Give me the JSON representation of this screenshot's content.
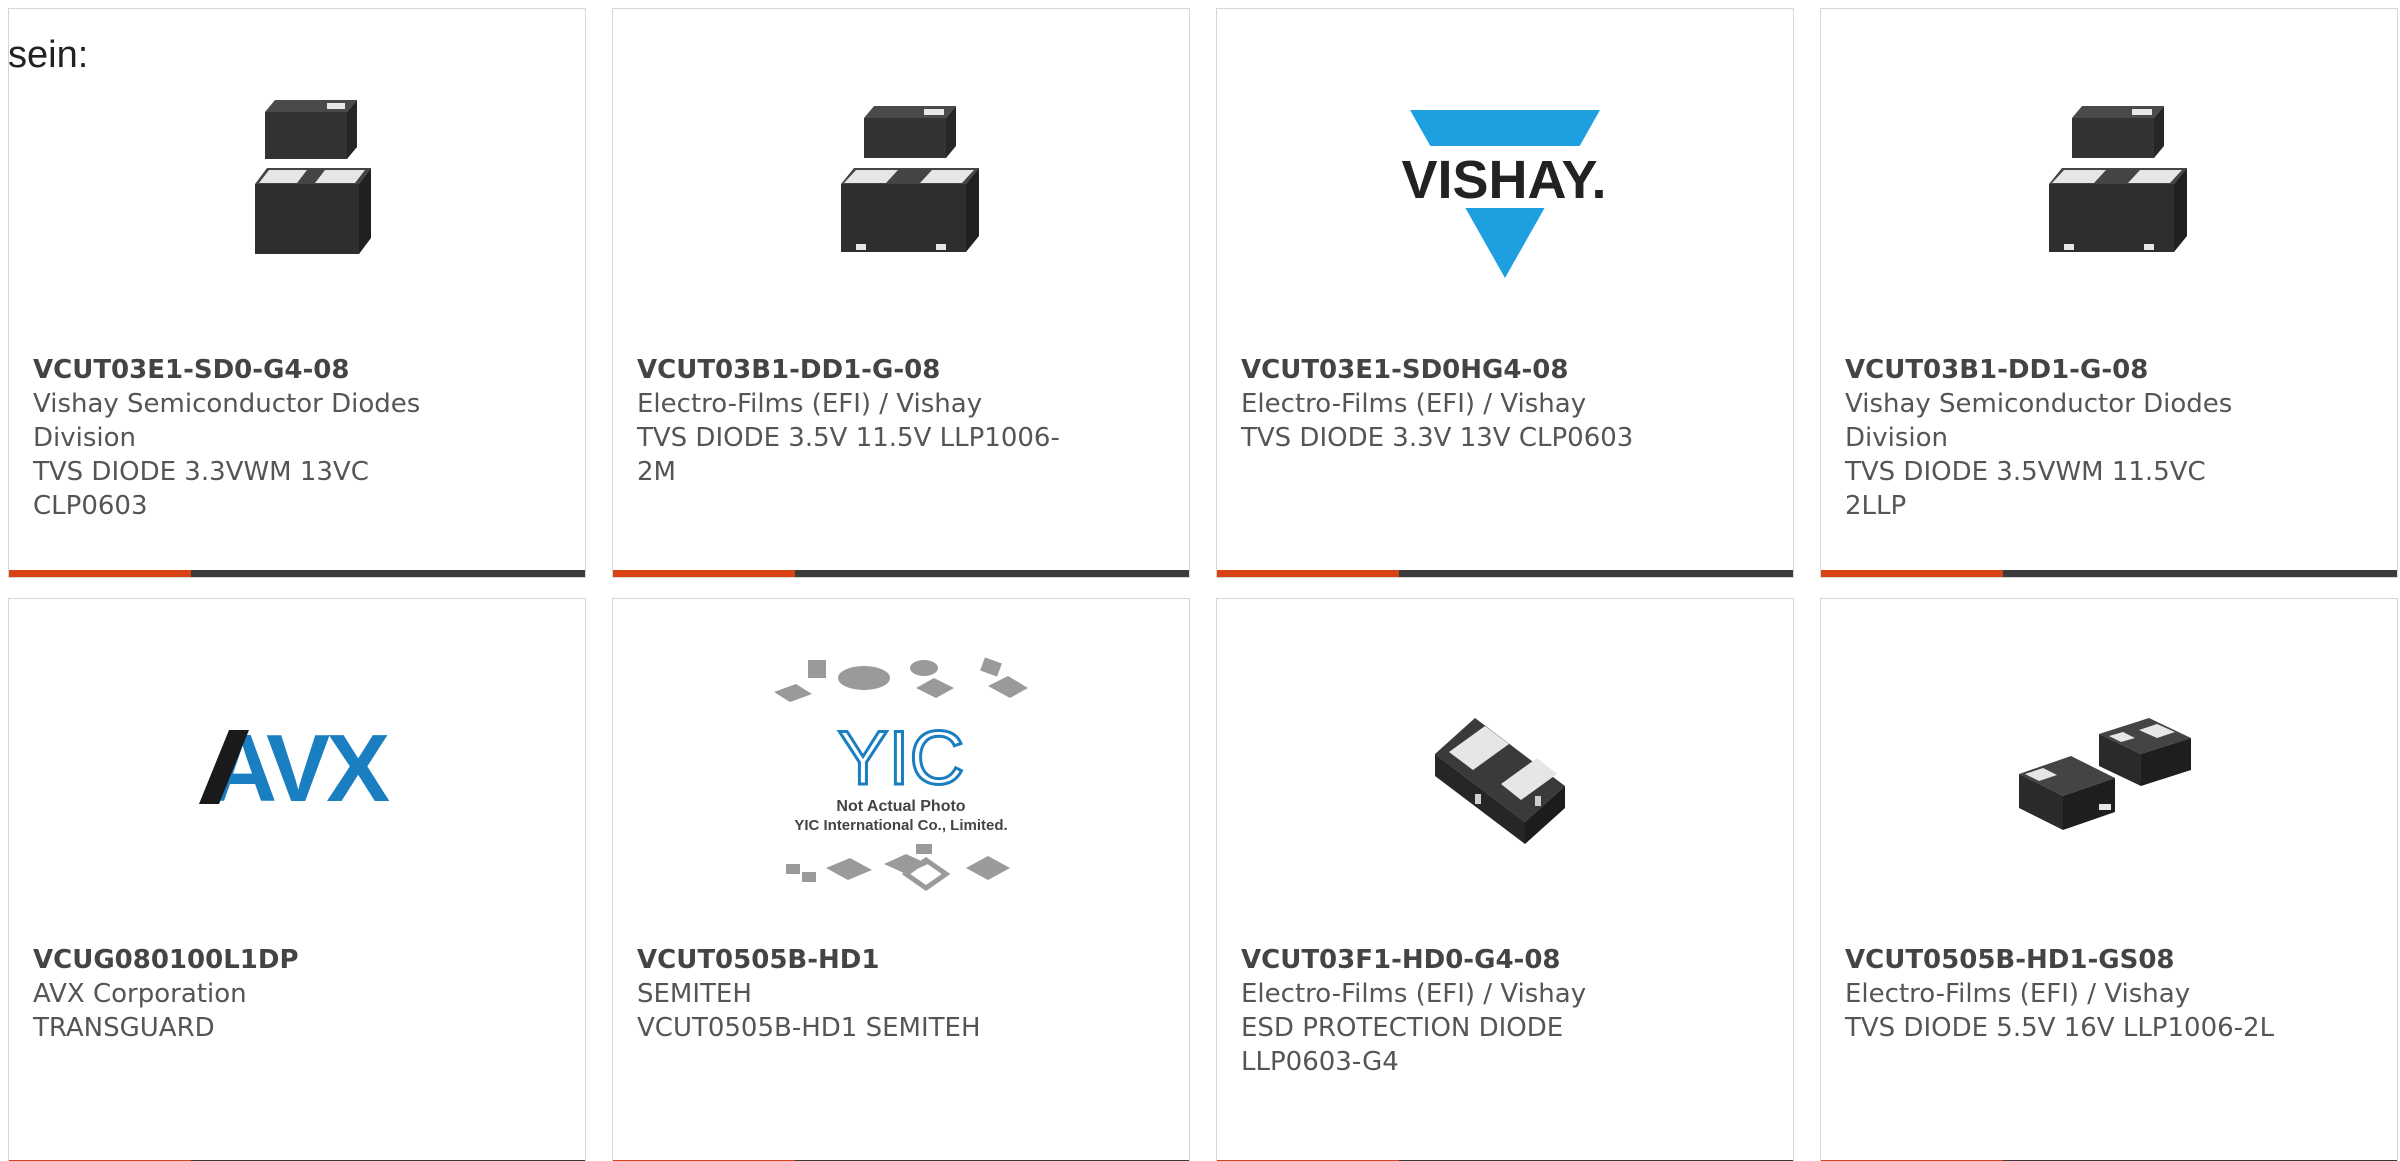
{
  "intro_text": "sein:",
  "colors": {
    "accent": "#d84315",
    "bar": "#3b3b3b",
    "card_border": "#d6d6d6",
    "vishay_blue": "#1ea0e0",
    "avx_blue": "#1a7fc1"
  },
  "cards": [
    {
      "part": "VCUT03E1-SD0-G4-08",
      "maker": "Vishay Semiconductor Diodes Division",
      "desc": "TVS DIODE 3.3VWM 13VC CLP0603",
      "image_icon": "dual-chip-icon"
    },
    {
      "part": "VCUT03B1-DD1-G-08",
      "maker": "Electro-Films (EFI) / Vishay",
      "desc": "TVS DIODE 3.5V 11.5V LLP1006-2M",
      "image_icon": "dual-chip-icon"
    },
    {
      "part": "VCUT03E1-SD0HG4-08",
      "maker": "Electro-Films (EFI) / Vishay",
      "desc": "TVS DIODE 3.3V 13V CLP0603",
      "image_icon": "vishay-logo",
      "logo_text": "VISHAY."
    },
    {
      "part": "VCUT03B1-DD1-G-08",
      "maker": "Vishay Semiconductor Diodes Division",
      "desc": "TVS DIODE 3.5VWM 11.5VC 2LLP",
      "image_icon": "dual-chip-icon"
    },
    {
      "part": "VCUG080100L1DP",
      "maker": "AVX Corporation",
      "desc": "TRANSGUARD",
      "image_icon": "avx-logo",
      "logo_text": "AVX"
    },
    {
      "part": "VCUT0505B-HD1",
      "maker": "SEMITEH",
      "desc": "VCUT0505B-HD1 SEMITEH",
      "image_icon": "yic-placeholder-icon",
      "logo_text": "YIC",
      "caption_line1": "Not Actual Photo",
      "caption_line2": "YIC International Co., Limited."
    },
    {
      "part": "VCUT03F1-HD0-G4-08",
      "maker": "Electro-Films (EFI) / Vishay",
      "desc": "ESD PROTECTION DIODE LLP0603-G4",
      "image_icon": "single-chip-icon"
    },
    {
      "part": "VCUT0505B-HD1-GS08",
      "maker": "Electro-Films (EFI) / Vishay",
      "desc": "TVS DIODE 5.5V 16V LLP1006-2L",
      "image_icon": "two-chips-icon"
    }
  ]
}
